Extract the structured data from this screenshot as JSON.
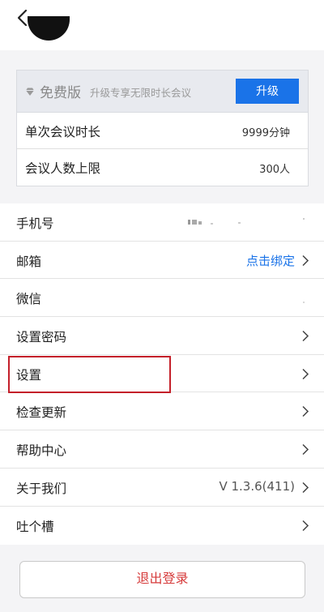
{
  "header": {
    "back_icon": "chevron-left-icon"
  },
  "plan": {
    "edition_label": "免费版",
    "upgrade_tip": "升级专享无限时长会议",
    "upgrade_button": "升级",
    "rows": [
      {
        "label": "单次会议时长",
        "value": "9999分钟"
      },
      {
        "label": "会议人数上限",
        "value": "300人"
      }
    ]
  },
  "menu": {
    "items": [
      {
        "label": "手机号",
        "value": ""
      },
      {
        "label": "邮箱",
        "value": "点击绑定"
      },
      {
        "label": "微信",
        "value": ""
      },
      {
        "label": "设置密码",
        "value": ""
      },
      {
        "label": "设置",
        "value": ""
      },
      {
        "label": "检查更新",
        "value": ""
      },
      {
        "label": "帮助中心",
        "value": ""
      },
      {
        "label": "关于我们",
        "value": "V 1.3.6(411)"
      },
      {
        "label": "吐个槽",
        "value": ""
      }
    ]
  },
  "logout": {
    "label": "退出登录"
  },
  "colors": {
    "accent": "#1a73e8",
    "highlight": "#c4202a",
    "logout_text": "#d63b3b"
  }
}
